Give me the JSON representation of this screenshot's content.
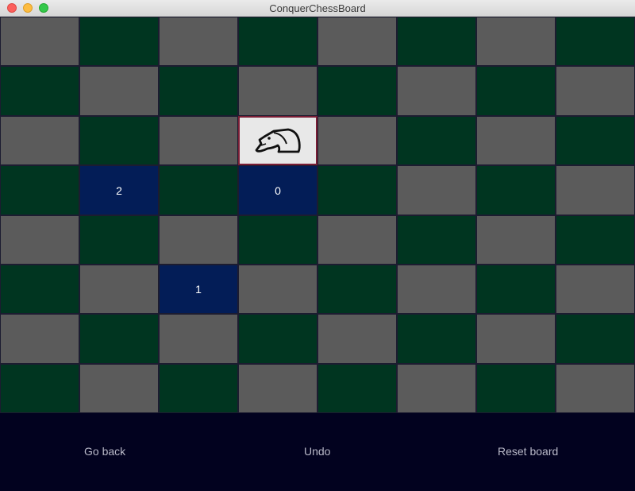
{
  "window": {
    "title": "ConquerChessBoard"
  },
  "board": {
    "rows": 8,
    "cols": 8,
    "colors": {
      "light": "#5b5b5b",
      "dark": "#003520",
      "move_highlight": "#031d57",
      "selected_bg": "#e8e8e8",
      "selected_border": "#7a1e35"
    },
    "knight": {
      "row": 2,
      "col": 3,
      "icon": "knight-icon"
    },
    "moves": [
      {
        "row": 3,
        "col": 3,
        "label": "0"
      },
      {
        "row": 5,
        "col": 2,
        "label": "1"
      },
      {
        "row": 3,
        "col": 1,
        "label": "2"
      }
    ]
  },
  "footer": {
    "go_back_label": "Go back",
    "undo_label": "Undo",
    "reset_label": "Reset board"
  }
}
